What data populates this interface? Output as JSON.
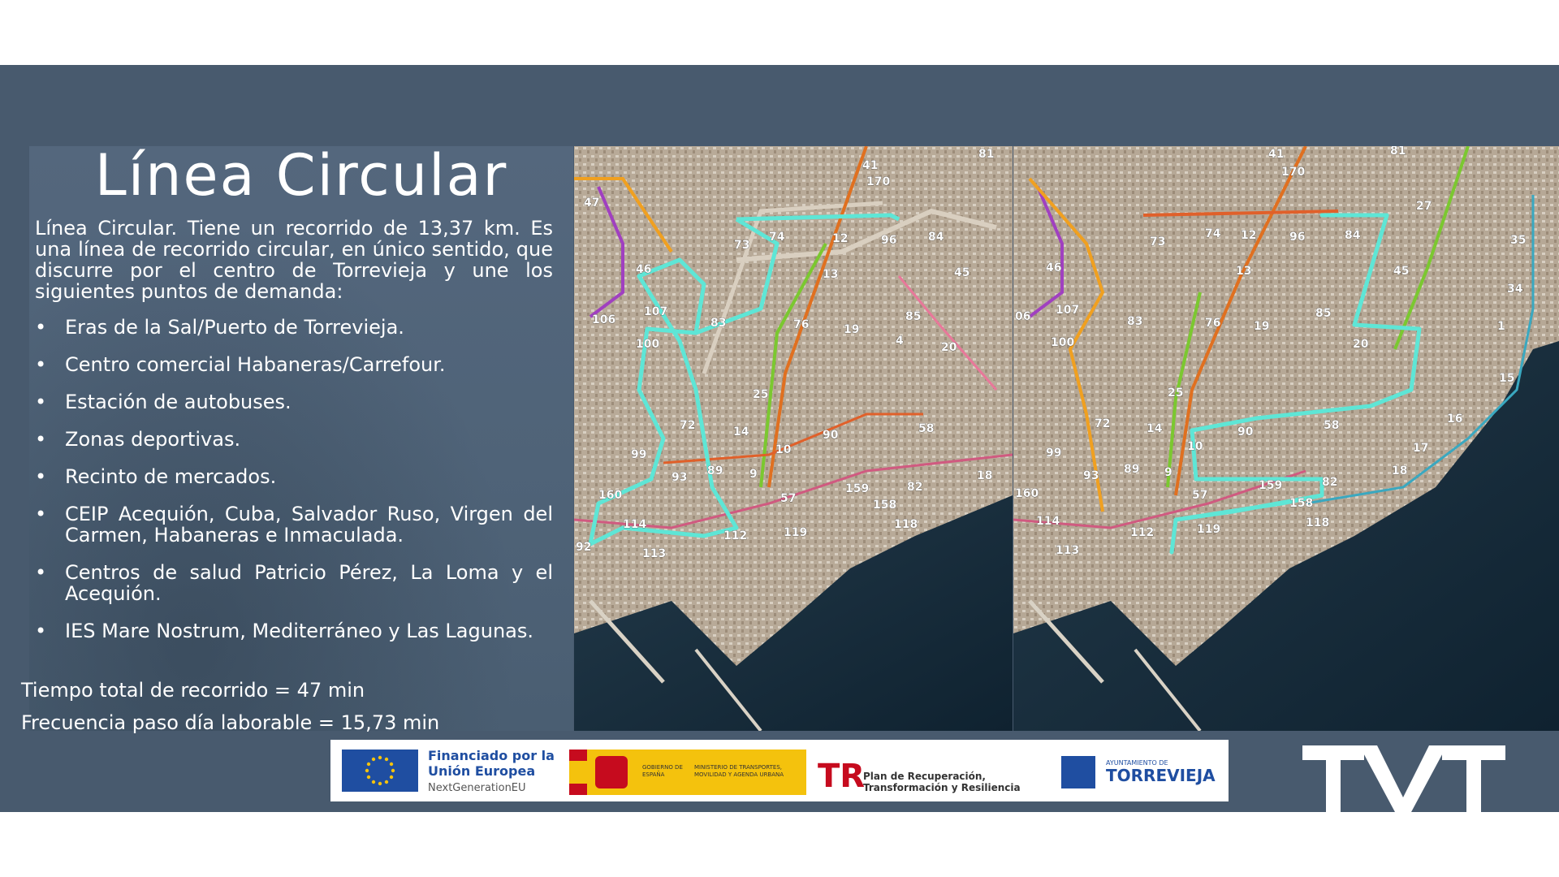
{
  "slide": {
    "title": "Línea Circular",
    "intro": "Línea Circular. Tiene un recorrido de 13,37 km. Es una línea de recorrido circular, en único sentido, que discurre por el centro de Torrevieja y une los siguientes puntos de demanda:",
    "bullets": [
      "Eras de la Sal/Puerto de Torrevieja.",
      "Centro comercial Habaneras/Carrefour.",
      "Estación de autobuses.",
      "Zonas deportivas.",
      "Recinto de mercados.",
      "CEIP Acequión, Cuba, Salvador Ruso, Virgen del Carmen, Habaneras e Inmaculada.",
      "Centros de salud Patricio Pérez, La Loma y el Acequión.",
      "IES Mare Nostrum, Mediterráneo y Las Lagunas."
    ],
    "bullet_marker": "•",
    "total_time": "Tiempo total de recorrido = 47 min",
    "frequency": "Frecuencia paso día laborable = 15,73 min"
  },
  "map_left": {
    "stop_labels": [
      "41",
      "170",
      "81",
      "47",
      "73",
      "74",
      "12",
      "96",
      "84",
      "46",
      "13",
      "45",
      "106",
      "107",
      "83",
      "85",
      "100",
      "76",
      "19",
      "4",
      "20",
      "25",
      "72",
      "14",
      "90",
      "58",
      "99",
      "10",
      "93",
      "89",
      "9",
      "159",
      "82",
      "18",
      "160",
      "57",
      "158",
      "114",
      "112",
      "119",
      "118",
      "113",
      "92"
    ]
  },
  "map_right": {
    "stop_labels": [
      "41",
      "170",
      "81",
      "27",
      "74",
      "12",
      "96",
      "84",
      "73",
      "13",
      "45",
      "35",
      "34",
      "06",
      "46",
      "107",
      "83",
      "85",
      "19",
      "20",
      "1",
      "100",
      "76",
      "25",
      "15",
      "72",
      "14",
      "90",
      "58",
      "16",
      "99",
      "10",
      "17",
      "93",
      "89",
      "9",
      "18",
      "160",
      "57",
      "159",
      "82",
      "158",
      "114",
      "112",
      "119",
      "118",
      "113"
    ]
  },
  "colors": {
    "background_band": "#485a6e",
    "circular_line": "#5ee6d6",
    "text": "#ffffff"
  },
  "footer_logos": {
    "eu_title": "Financiado por la Unión Europea",
    "eu_sub": "NextGenerationEU",
    "gobierno": "GOBIERNO DE ESPAÑA",
    "ministerio": "MINISTERIO DE TRANSPORTES, MOVILIDAD Y AGENDA URBANA",
    "prtr": "Plan de Recuperación, Transformación y Resiliencia",
    "ayto_small": "AYUNTAMIENTO DE",
    "ayto_big": "TORREVIEJA"
  },
  "brand": {
    "logo_text": "TVT"
  }
}
